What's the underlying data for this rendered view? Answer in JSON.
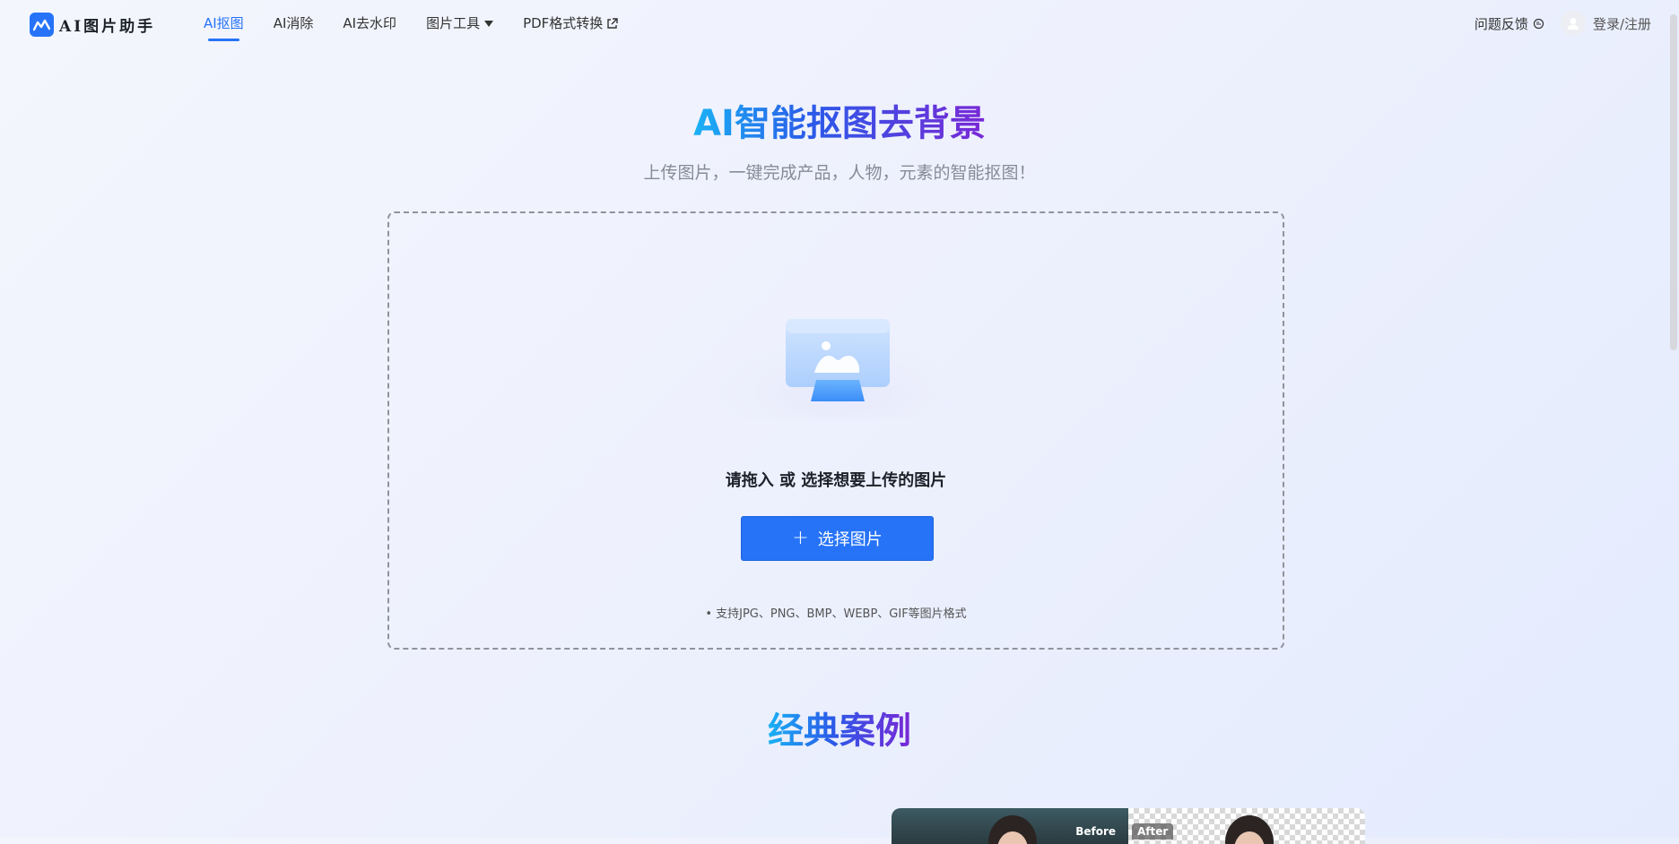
{
  "header": {
    "logo_text": "AI图片助手",
    "nav": [
      {
        "label": "AI抠图",
        "active": true
      },
      {
        "label": "AI消除"
      },
      {
        "label": "AI去水印"
      },
      {
        "label": "图片工具",
        "has_dropdown": true
      },
      {
        "label": "PDF格式转换",
        "external": true
      }
    ],
    "feedback_label": "问题反馈",
    "login_label": "登录/注册"
  },
  "hero": {
    "title": "AI智能抠图去背景",
    "subtitle": "上传图片，一键完成产品，人物，元素的智能抠图！"
  },
  "upload": {
    "drop_text": "请拖入 或 选择想要上传的图片",
    "button_label": "选择图片",
    "format_note": "• 支持JPG、PNG、BMP、WEBP、GIF等图片格式"
  },
  "cases": {
    "title": "经典案例",
    "before_label": "Before",
    "after_label": "After"
  },
  "colors": {
    "accent": "#2673f8",
    "gradient_start": "#1ab2f5",
    "gradient_end": "#7a28d6"
  },
  "icons": [
    "logo-icon",
    "chevron-down-icon",
    "external-link-icon",
    "feedback-icon",
    "user-icon",
    "image-upload-icon",
    "plus-icon"
  ]
}
